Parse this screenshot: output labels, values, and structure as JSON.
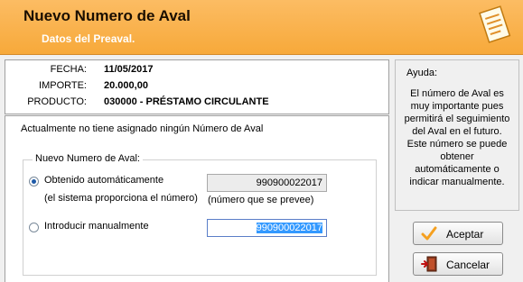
{
  "header": {
    "title": "Nuevo Numero de Aval",
    "subtitle": "Datos del Preaval."
  },
  "info": {
    "fecha": {
      "label": "FECHA:",
      "value": "11/05/2017"
    },
    "importe": {
      "label": "IMPORTE:",
      "value": "20.000,00"
    },
    "producto": {
      "label": "PRODUCTO:",
      "value": "030000 - PRÉSTAMO CIRCULANTE"
    }
  },
  "message": "Actualmente no tiene asignado ningún Número de Aval",
  "group": {
    "legend": "Nuevo Numero de Aval:",
    "auto": {
      "label": "Obtenido automáticamente",
      "sublabel": "(el sistema proporciona el número)",
      "value": "990900022017",
      "note": "(número que se prevee)",
      "checked": true
    },
    "manual": {
      "label": "Introducir manualmente",
      "value": "990900022017",
      "checked": false
    }
  },
  "help": {
    "title": "Ayuda:",
    "text": "El número de Aval es muy importante pues permitirá el seguimiento del Aval en el futuro. Este número se puede obtener automáticamente o indicar manualmente."
  },
  "buttons": {
    "accept": "Aceptar",
    "cancel": "Cancelar"
  },
  "colors": {
    "header_bg": "#f7a93a",
    "selection": "#3399ff"
  },
  "icons": {
    "header": "document-notepad-icon",
    "accept": "checkmark-icon",
    "cancel": "exit-door-icon"
  }
}
